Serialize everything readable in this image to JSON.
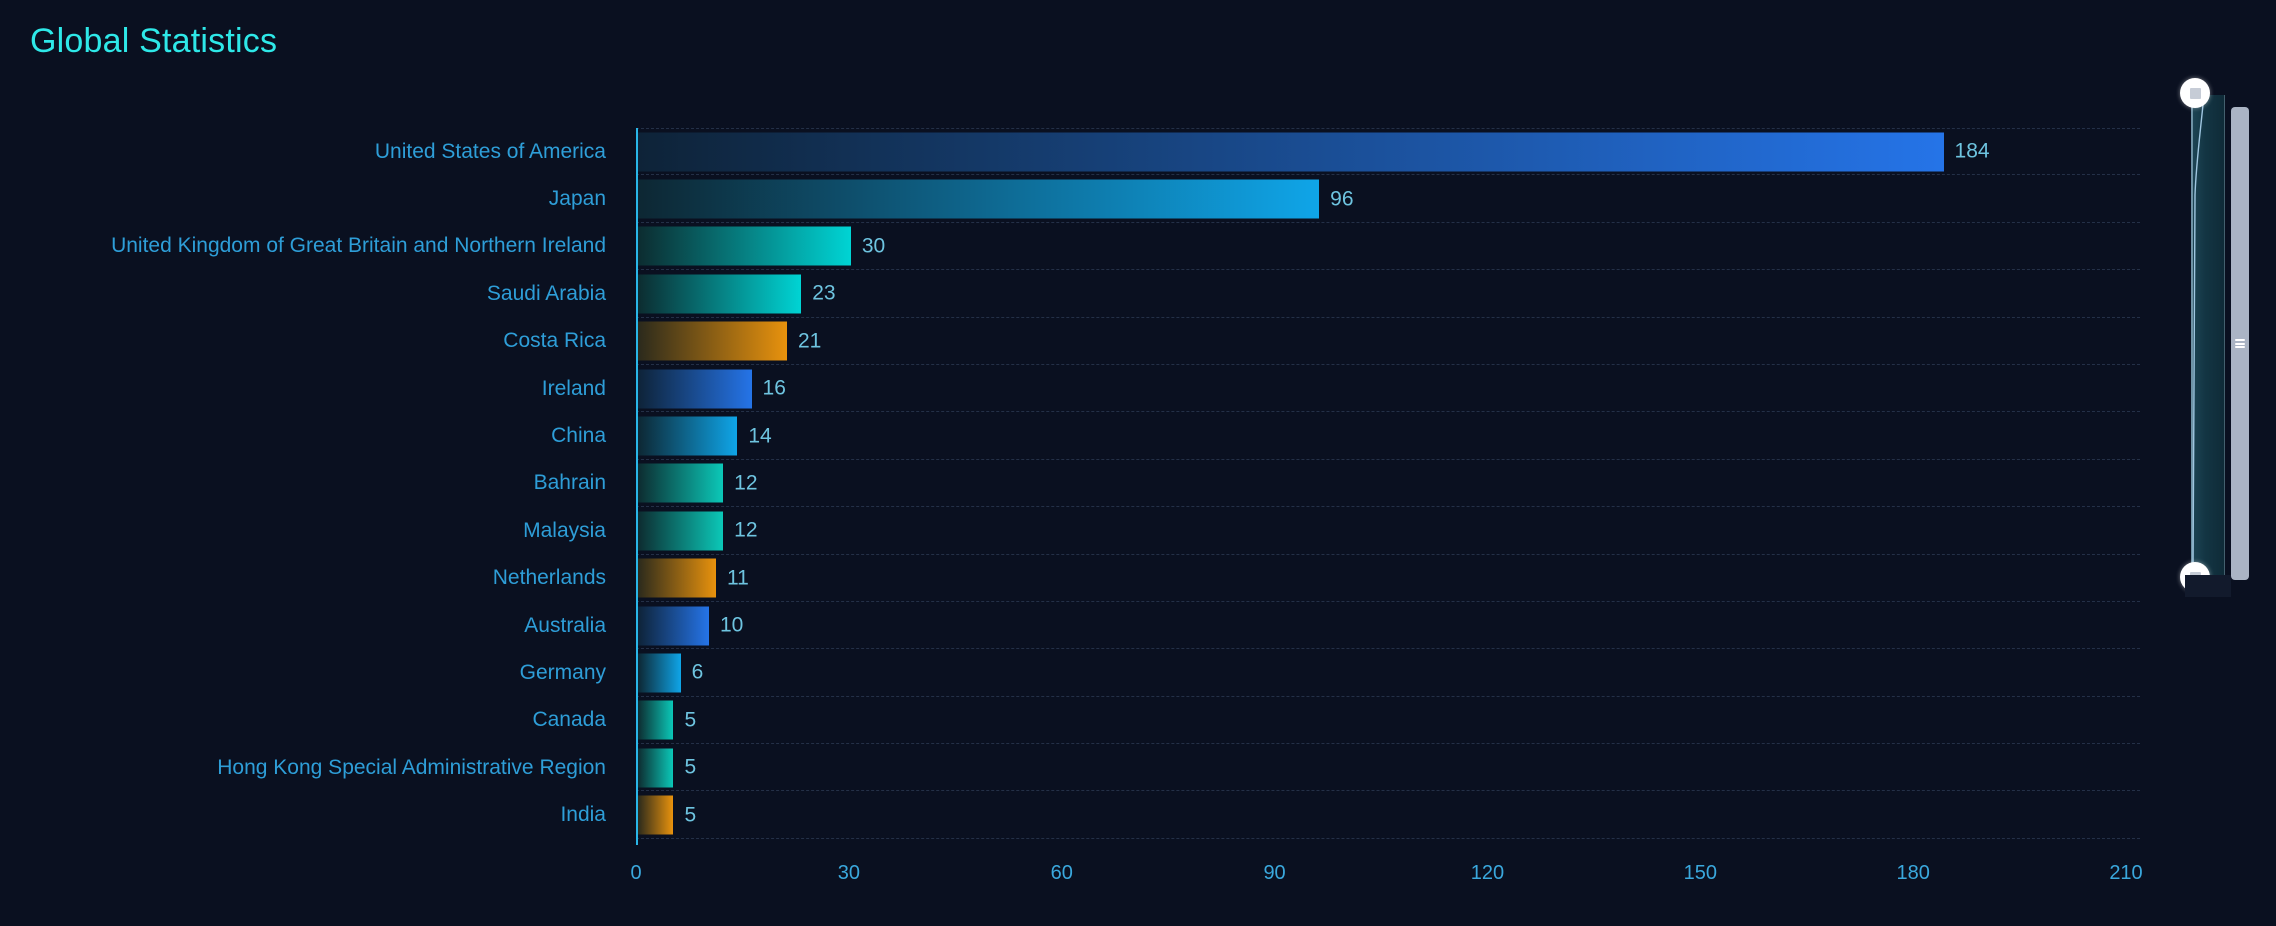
{
  "chart_title": "Global Statistics",
  "colors": {
    "background": "#0a1020",
    "title": "#2ee8e8",
    "category_label": "#2e9ed8",
    "value_label": "#6ec4e0",
    "axis_tick": "#3aa8dd",
    "axis_line": "#29b6e8",
    "gridline": "#243047",
    "bar_blue_end": "#2574e8",
    "bar_azure_end": "#0fa5e8",
    "bar_cyan_end": "#00d4d4",
    "bar_teal_end": "#0bc8b8",
    "bar_orange_end": "#e8920d",
    "bar_dark_start": "#0d2a2e",
    "handle_fill": "#ffffff",
    "scrollbar_thumb": "#aab4c4"
  },
  "chart_data": {
    "type": "bar",
    "orientation": "horizontal",
    "title": "Global Statistics",
    "xlabel": "",
    "ylabel": "",
    "xlim": [
      0,
      210
    ],
    "grid": true,
    "legend": "none",
    "x_ticks": [
      "0",
      "30",
      "60",
      "90",
      "120",
      "150",
      "180",
      "210"
    ],
    "x_tick_values": [
      0,
      30,
      60,
      90,
      120,
      150,
      180,
      210
    ],
    "categories": [
      "United States of America",
      "Japan",
      "United Kingdom of Great Britain and Northern Ireland",
      "Saudi Arabia",
      "Costa Rica",
      "Ireland",
      "China",
      "Bahrain",
      "Malaysia",
      "Netherlands",
      "Australia",
      "Germany",
      "Canada",
      "Hong Kong Special Administrative Region",
      "India"
    ],
    "values": [
      184,
      96,
      30,
      23,
      21,
      16,
      14,
      12,
      12,
      11,
      10,
      6,
      5,
      5,
      5
    ],
    "bar_colors": [
      "blue",
      "azure",
      "cyan",
      "cyan",
      "orange",
      "blue",
      "azure",
      "teal",
      "teal",
      "orange",
      "blue",
      "azure",
      "teal",
      "teal",
      "orange"
    ]
  },
  "bar_palette": {
    "blue": {
      "start": "#0e2338",
      "end": "#2574e8"
    },
    "azure": {
      "start": "#0d2733",
      "end": "#0fa5e8"
    },
    "cyan": {
      "start": "#0c2c30",
      "end": "#00d4d4"
    },
    "teal": {
      "start": "#0d2c30",
      "end": "#0bc8b8"
    },
    "orange": {
      "start": "#2b2a1c",
      "end": "#e8920d"
    }
  },
  "range_slider": {
    "name": "vertical-range-brush",
    "top_handle": "range-handle-top",
    "bottom_handle": "range-handle-bottom"
  },
  "scrollbar": {
    "name": "vertical-scrollbar",
    "grip": "scrollbar-grip"
  }
}
